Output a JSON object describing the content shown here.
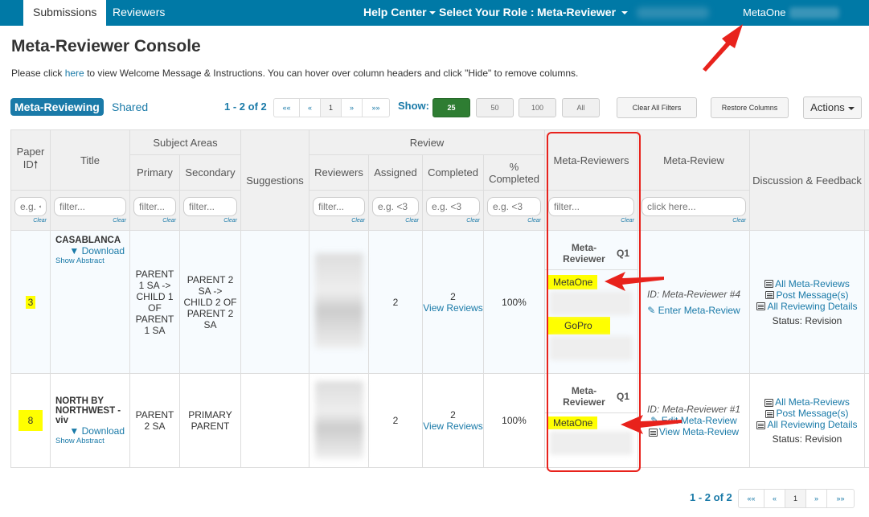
{
  "nav": {
    "tabs": [
      "Submissions",
      "Reviewers"
    ],
    "help_center": "Help Center",
    "select_role_label": "Select Your Role :",
    "role": "Meta-Reviewer",
    "user": "MetaOne"
  },
  "page": {
    "title": "Meta-Reviewer Console",
    "intro_prefix": "Please click ",
    "intro_link": "here",
    "intro_suffix": " to view Welcome Message & Instructions. You can hover over column headers and click \"Hide\" to remove columns."
  },
  "toolbar": {
    "tabs": [
      "Meta-Reviewing",
      "Shared"
    ],
    "range": "1 - 2 of 2",
    "pager": [
      "««",
      "«",
      "1",
      "»",
      "»»"
    ],
    "show_label": "Show:",
    "page_sizes": [
      "25",
      "50",
      "100",
      "All"
    ],
    "selected_page_size": "25",
    "clear_filters": "Clear All Filters",
    "restore_columns": "Restore Columns",
    "actions": "Actions"
  },
  "table": {
    "headers": {
      "paper_id": "Paper ID",
      "title": "Title",
      "subject_areas": "Subject Areas",
      "primary": "Primary",
      "secondary": "Secondary",
      "suggestions": "Suggestions",
      "review": "Review",
      "reviewers": "Reviewers",
      "assigned": "Assigned",
      "completed": "Completed",
      "pct_completed": "% Completed",
      "meta_reviewers": "Meta-Reviewers",
      "meta_review": "Meta-Review",
      "discussion": "Discussion & Feedback"
    },
    "filters": {
      "paper_id": "e.g. <",
      "title": "filter...",
      "primary": "filter...",
      "secondary": "filter...",
      "reviewers": "filter...",
      "assigned": "e.g. <3",
      "completed": "e.g. <3",
      "pct_completed": "e.g. <3",
      "meta_reviewers": "filter...",
      "meta_review": "click here...",
      "clear_label": "Clear"
    },
    "sub_headers": {
      "meta_reviewer": "Meta-Reviewer",
      "q1": "Q1"
    },
    "rows": [
      {
        "id": "3",
        "title": "CASABLANCA",
        "download": "Download",
        "show_abstract": "Show Abstract",
        "primary": "PARENT 1 SA -> CHILD 1 OF PARENT 1 SA",
        "secondary": "PARENT 2 SA -> CHILD 2 OF PARENT 2 SA",
        "assigned": "2",
        "completed": "2",
        "view_reviews": "View Reviews",
        "pct": "100%",
        "meta_reviewers": [
          "MetaOne",
          "GoPro"
        ],
        "meta_id": "ID: Meta-Reviewer #4",
        "meta_links": [
          "Enter Meta-Review"
        ],
        "discussion_links": [
          "All Meta-Reviews",
          "Post Message(s)",
          "All Reviewing Details"
        ],
        "status": "Status: Revision"
      },
      {
        "id": "8",
        "title": "NORTH BY NORTHWEST - viv",
        "download": "Download",
        "show_abstract": "Show Abstract",
        "primary": "PARENT 2 SA",
        "secondary": "PRIMARY PARENT",
        "assigned": "2",
        "completed": "2",
        "view_reviews": "View Reviews",
        "pct": "100%",
        "meta_reviewers": [
          "MetaOne"
        ],
        "meta_id": "ID: Meta-Reviewer #1",
        "meta_links": [
          "Edit Meta-Review",
          "View Meta-Review"
        ],
        "discussion_links": [
          "All Meta-Reviews",
          "Post Message(s)",
          "All Reviewing Details"
        ],
        "status": "Status: Revision"
      }
    ]
  },
  "colors": {
    "nav_bg": "#0079a6",
    "link": "#1a7aa8",
    "active_size": "#2e7d32",
    "highlight": "#ffff00",
    "annotation": "#e8221c"
  }
}
